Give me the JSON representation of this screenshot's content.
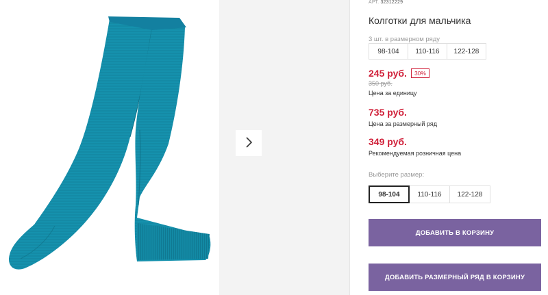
{
  "product": {
    "art_prefix": "АРТ.",
    "art_number": "32312229",
    "title": "Колготки для мальчика"
  },
  "set": {
    "label": "3 шт. в размерном ряду",
    "sizes": [
      "98-104",
      "110-116",
      "122-128"
    ]
  },
  "prices": {
    "unit_price": "245 руб.",
    "discount": "30%",
    "old_price": "350 руб.",
    "unit_caption": "Цена за единицу",
    "set_price": "735 руб.",
    "set_caption": "Цена за размерный ряд",
    "rrp": "349 руб.",
    "rrp_caption": "Рекомендуемая розничная цена",
    "accent_color": "#d0213a"
  },
  "size_picker": {
    "label": "Выберите размер:",
    "options": [
      "98-104",
      "110-116",
      "122-128"
    ],
    "selected": "98-104"
  },
  "actions": {
    "add_to_cart": "ДОБАВИТЬ В КОРЗИНУ",
    "add_set_to_cart": "ДОБАВИТЬ РАЗМЕРНЫЙ РЯД В КОРЗИНУ",
    "button_color": "#7a63a0"
  },
  "gallery": {
    "next_icon": "chevron-right-icon",
    "product_color": "#1591ad"
  }
}
